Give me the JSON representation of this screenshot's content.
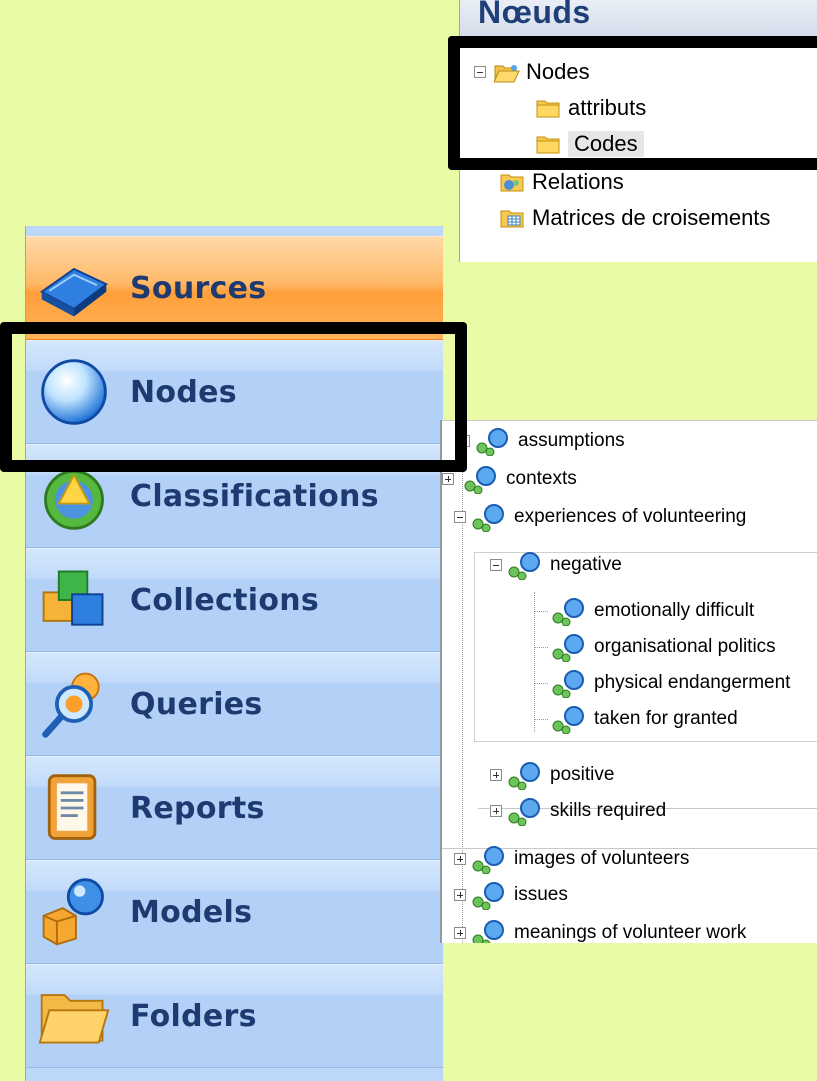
{
  "noeuds_panel": {
    "title": "Nœuds",
    "items": [
      {
        "label": "Nodes",
        "icon": "open-folder-icon",
        "expanded": true
      },
      {
        "label": "attributs",
        "icon": "folder-icon"
      },
      {
        "label": "Codes",
        "icon": "folder-icon",
        "selected": true
      },
      {
        "label": "Relations",
        "icon": "relations-folder-icon"
      },
      {
        "label": "Matrices de croisements",
        "icon": "matrix-folder-icon"
      }
    ]
  },
  "nav": {
    "items": [
      {
        "label": "Sources",
        "icon": "sources-icon",
        "active": true
      },
      {
        "label": "Nodes",
        "icon": "nodes-icon"
      },
      {
        "label": "Classifications",
        "icon": "classifications-icon"
      },
      {
        "label": "Collections",
        "icon": "collections-icon"
      },
      {
        "label": "Queries",
        "icon": "queries-icon"
      },
      {
        "label": "Reports",
        "icon": "reports-icon"
      },
      {
        "label": "Models",
        "icon": "models-icon"
      },
      {
        "label": "Folders",
        "icon": "folders-icon"
      }
    ]
  },
  "tree": {
    "nodes": [
      {
        "label": "assumptions",
        "level": 0,
        "expander": "plus"
      },
      {
        "label": "contexts",
        "level": 0,
        "expander": "plus"
      },
      {
        "label": "experiences of volunteering",
        "level": 0,
        "expander": "minus"
      },
      {
        "label": "negative",
        "level": 1,
        "expander": "minus"
      },
      {
        "label": "emotionally difficult",
        "level": 2,
        "expander": "none"
      },
      {
        "label": "organisational politics",
        "level": 2,
        "expander": "none"
      },
      {
        "label": "physical endangerment",
        "level": 2,
        "expander": "none"
      },
      {
        "label": "taken for granted",
        "level": 2,
        "expander": "none"
      },
      {
        "label": "positive",
        "level": 1,
        "expander": "plus"
      },
      {
        "label": "skills required",
        "level": 1,
        "expander": "plus"
      },
      {
        "label": "images of volunteers",
        "level": 0,
        "expander": "plus"
      },
      {
        "label": "issues",
        "level": 0,
        "expander": "plus"
      },
      {
        "label": "meanings of volunteer work",
        "level": 0,
        "expander": "plus"
      }
    ]
  },
  "colors": {
    "background": "#eafba6",
    "nav_active": "#ff9f3a",
    "nav_item": "#b3d1f7",
    "nav_text": "#1e3a70",
    "highlight_box": "#000000"
  }
}
